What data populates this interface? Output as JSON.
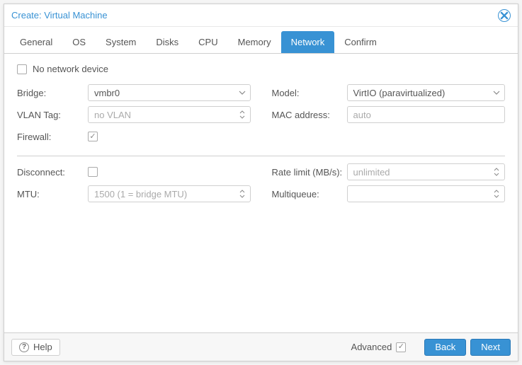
{
  "title": "Create: Virtual Machine",
  "tabs": {
    "general": "General",
    "os": "OS",
    "system": "System",
    "disks": "Disks",
    "cpu": "CPU",
    "memory": "Memory",
    "network": "Network",
    "confirm": "Confirm"
  },
  "noNetworkLabel": "No network device",
  "left": {
    "bridge": {
      "label": "Bridge:",
      "value": "vmbr0"
    },
    "vlan": {
      "label": "VLAN Tag:",
      "placeholder": "no VLAN"
    },
    "firewall": {
      "label": "Firewall:"
    },
    "disconnect": {
      "label": "Disconnect:"
    },
    "mtu": {
      "label": "MTU:",
      "placeholder": "1500 (1 = bridge MTU)"
    }
  },
  "right": {
    "model": {
      "label": "Model:",
      "value": "VirtIO (paravirtualized)"
    },
    "mac": {
      "label": "MAC address:",
      "placeholder": "auto"
    },
    "ratelimit": {
      "label": "Rate limit (MB/s):",
      "placeholder": "unlimited"
    },
    "multiqueue": {
      "label": "Multiqueue:"
    }
  },
  "footer": {
    "help": "Help",
    "advanced": "Advanced",
    "back": "Back",
    "next": "Next"
  }
}
